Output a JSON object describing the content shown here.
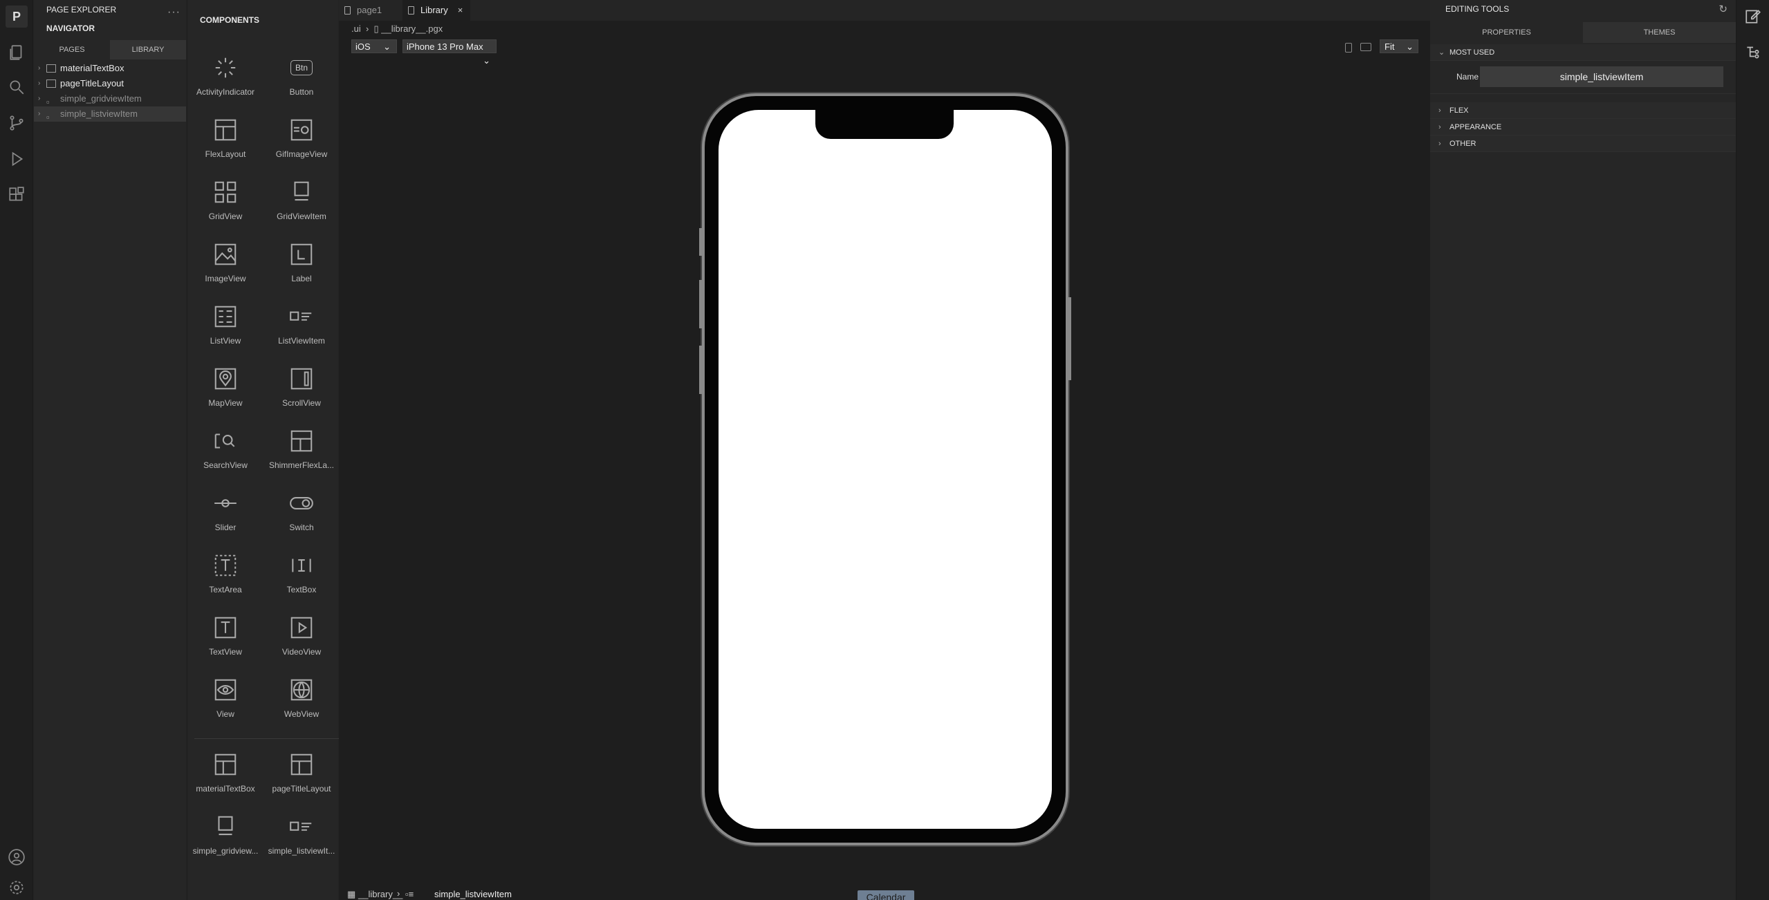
{
  "activity_bar": {
    "logo": "P"
  },
  "explorer": {
    "title": "PAGE EXPLORER",
    "navigator": "NAVIGATOR",
    "tabs": [
      "PAGES",
      "LIBRARY"
    ],
    "items": [
      {
        "label": "materialTextBox"
      },
      {
        "label": "pageTitleLayout"
      },
      {
        "label": "simple_gridviewItem"
      },
      {
        "label": "simple_listviewItem"
      }
    ]
  },
  "components": {
    "title": "COMPONENTS",
    "items": [
      {
        "label": "ActivityIndicator",
        "icon": "spinner-icon"
      },
      {
        "label": "Button",
        "icon": "button-icon",
        "glyph": "Btn"
      },
      {
        "label": "FlexLayout",
        "icon": "flexlayout-icon"
      },
      {
        "label": "GifImageView",
        "icon": "gif-image-icon"
      },
      {
        "label": "GridView",
        "icon": "grid-icon"
      },
      {
        "label": "GridViewItem",
        "icon": "grid-item-icon"
      },
      {
        "label": "ImageView",
        "icon": "image-icon"
      },
      {
        "label": "Label",
        "icon": "label-icon"
      },
      {
        "label": "ListView",
        "icon": "list-icon"
      },
      {
        "label": "ListViewItem",
        "icon": "list-item-icon"
      },
      {
        "label": "MapView",
        "icon": "map-pin-icon"
      },
      {
        "label": "ScrollView",
        "icon": "scroll-icon"
      },
      {
        "label": "SearchView",
        "icon": "search-view-icon"
      },
      {
        "label": "ShimmerFlexLa...",
        "icon": "shimmer-icon"
      },
      {
        "label": "Slider",
        "icon": "slider-icon"
      },
      {
        "label": "Switch",
        "icon": "switch-icon"
      },
      {
        "label": "TextArea",
        "icon": "textarea-icon"
      },
      {
        "label": "TextBox",
        "icon": "textbox-icon"
      },
      {
        "label": "TextView",
        "icon": "textview-icon"
      },
      {
        "label": "VideoView",
        "icon": "video-icon"
      },
      {
        "label": "View",
        "icon": "eye-icon"
      },
      {
        "label": "WebView",
        "icon": "globe-icon"
      }
    ],
    "library": [
      {
        "label": "materialTextBox",
        "icon": "flexlayout-icon"
      },
      {
        "label": "pageTitleLayout",
        "icon": "flexlayout-icon"
      },
      {
        "label": "simple_gridview...",
        "icon": "grid-item-icon"
      },
      {
        "label": "simple_listviewIt...",
        "icon": "list-item-icon"
      }
    ]
  },
  "editor": {
    "tabs": [
      {
        "label": "page1"
      },
      {
        "label": "Library",
        "close": "×"
      }
    ],
    "breadcrumb": [
      ".ui",
      "__library__.pgx"
    ],
    "platform": "iOS",
    "device": "iPhone 13 Pro Max",
    "zoom": "Fit",
    "status_path": [
      "__library__",
      "simple_listviewItem"
    ],
    "calendar_button": "Calendar"
  },
  "properties": {
    "title": "EDITING TOOLS",
    "tabs": [
      "PROPERTIES",
      "THEMES"
    ],
    "sections": [
      "MOST USED",
      "FLEX",
      "APPEARANCE",
      "OTHER"
    ],
    "name_label": "Name",
    "name_value": "simple_listviewItem"
  }
}
